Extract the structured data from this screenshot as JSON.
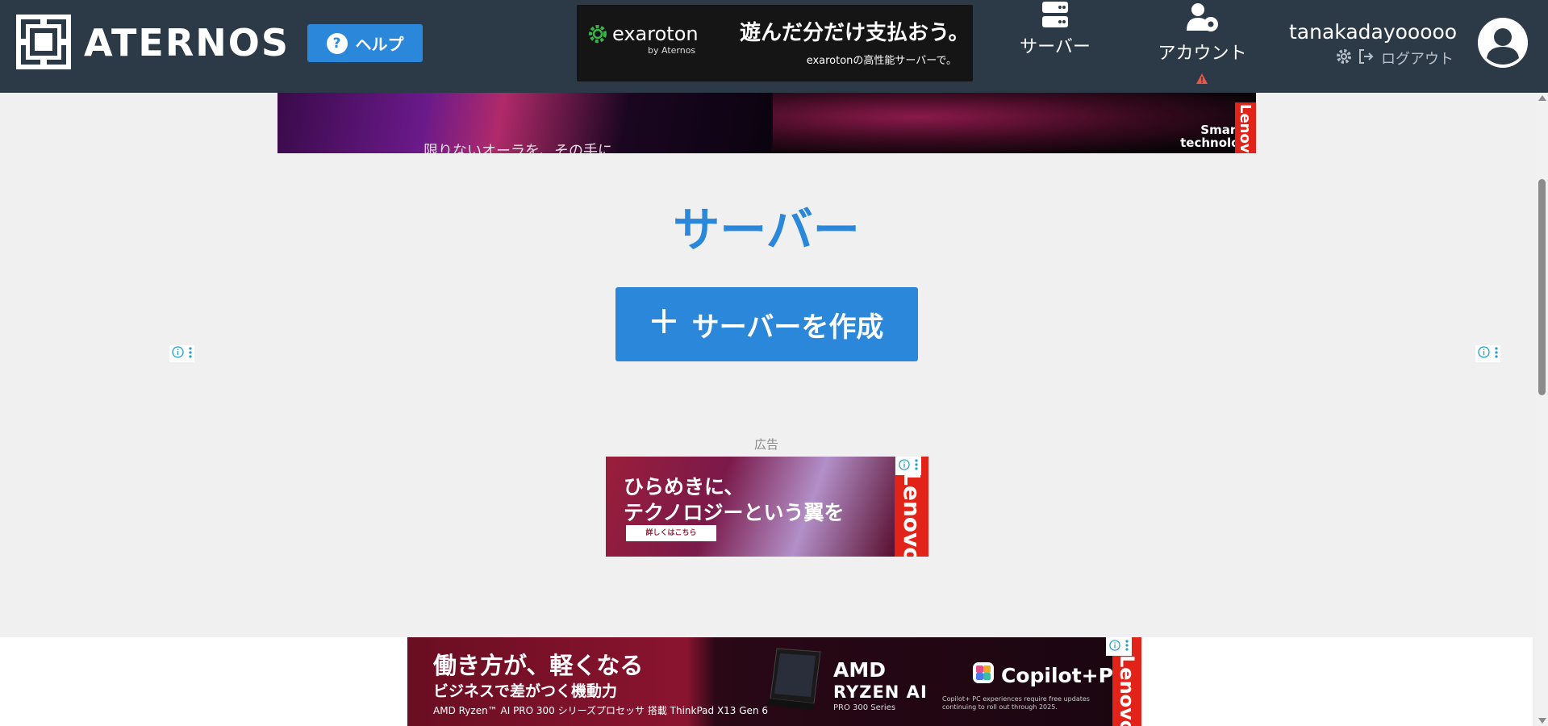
{
  "header": {
    "logo_text": "ATERNOS",
    "help_label": "ヘルプ",
    "help_icon": "?",
    "nav": {
      "servers_label": "サーバー",
      "account_label": "アカウント"
    },
    "user": {
      "name": "tanakadayooooo",
      "logout_label": "ログアウト"
    }
  },
  "header_ad": {
    "brand": "exaroton",
    "brand_by": "by Aternos",
    "headline": "遊んだ分だけ支払おう。",
    "subline": "exarotonの高性能サーバーで。"
  },
  "top_ad": {
    "tagline": "限りないオーラを、その手に",
    "side_text": "Smarter technology",
    "brand": "Lenovo"
  },
  "main": {
    "title": "サーバー",
    "create_label": "サーバーを作成",
    "create_icon": "+",
    "ad_label": "広告"
  },
  "mid_ad": {
    "line1": "ひらめきに、",
    "line2": "テクノロジーという翼を",
    "cta": "詳しくはこちら",
    "brand": "Lenovo"
  },
  "bottom_ad": {
    "headline": "働き方が、軽くなる",
    "subline": "ビジネスで差がつく機動力",
    "detail": "AMD Ryzen™ AI PRO 300 シリーズプロセッサ 搭載 ThinkPad X13 Gen 6",
    "amd": "AMD",
    "ryzen": "RYZEN AI",
    "ryzen_sub": "PRO 300 Series",
    "copilot": "Copilot+PC",
    "fine_print": "Copilot+ PC experiences require free updates continuing to roll out through 2025.",
    "brand": "Lenovo"
  },
  "colors": {
    "header_bg": "#2c3a47",
    "accent": "#2b87d9",
    "page_bg": "#f0f0f0",
    "lenovo_red": "#e2231a"
  }
}
